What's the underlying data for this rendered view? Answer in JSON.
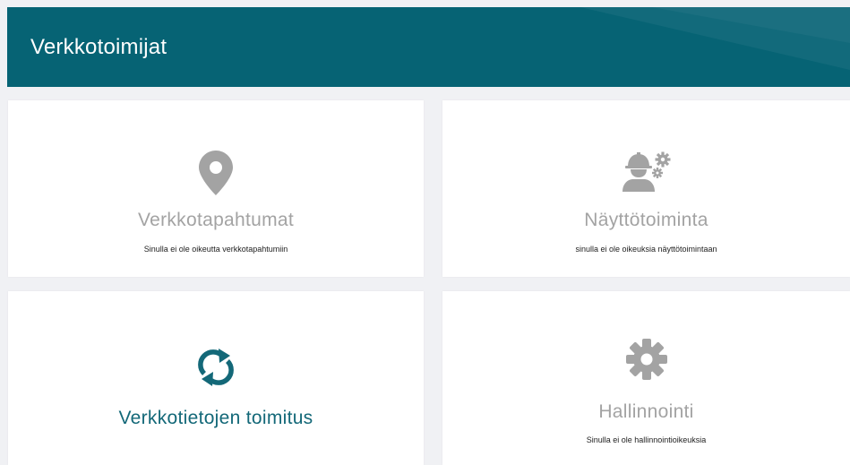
{
  "header": {
    "title": "Verkkotoimijat"
  },
  "cards": [
    {
      "title": "Verkkotapahtumat",
      "subtitle": "Sinulla ei ole oikeutta verkkotapahtumiin",
      "icon": "map-marker-icon"
    },
    {
      "title": "Näyttötoiminta",
      "subtitle": "sinulla ei ole oikeuksia näyttötoimintaan",
      "icon": "worker-gears-icon"
    },
    {
      "title": "Verkkotietojen toimitus",
      "subtitle": "",
      "icon": "sync-arrows-icon"
    },
    {
      "title": "Hallinnointi",
      "subtitle": "Sinulla ei ole hallinnointioikeuksia",
      "icon": "gear-icon"
    }
  ],
  "colors": {
    "header_bg": "#066374",
    "accent": "#136878",
    "disabled": "#a3a3a3",
    "page_bg": "#f0f1f4"
  }
}
